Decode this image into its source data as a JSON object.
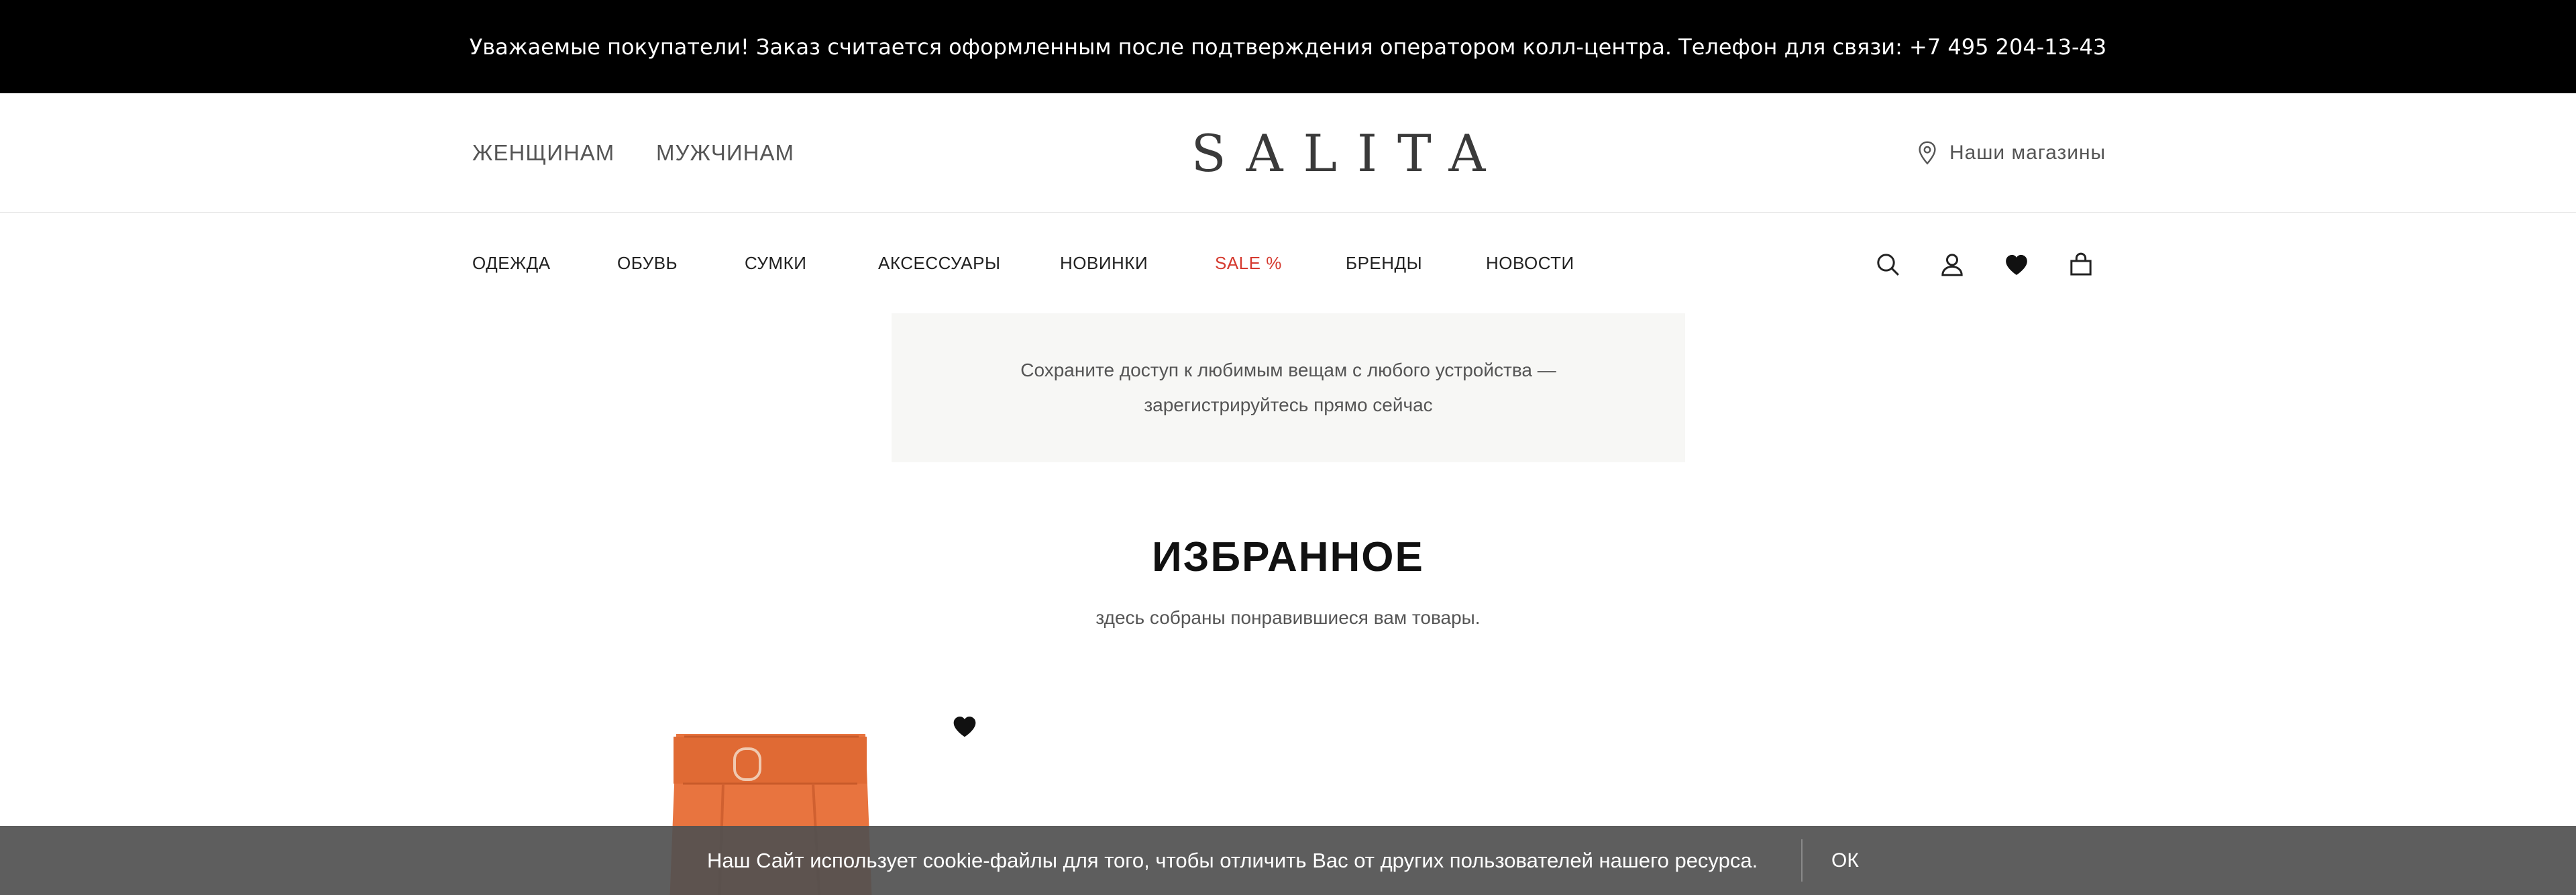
{
  "announcement": "Уважаемые покупатели! Заказ считается оформленным после подтверждения оператором колл-центра. Телефон для связи: +7 495 204-13-43",
  "header": {
    "women": "ЖЕНЩИНАМ",
    "men": "МУЖЧИНАМ",
    "logo": "SALITA",
    "stores": "Наши магазины"
  },
  "nav": {
    "items": [
      "ОДЕЖДА",
      "ОБУВЬ",
      "СУМКИ",
      "АКСЕССУАРЫ",
      "НОВИНКИ",
      "SALE %",
      "БРЕНДЫ",
      "НОВОСТИ"
    ],
    "icons": [
      "search-icon",
      "user-icon",
      "heart-icon",
      "bag-icon"
    ],
    "sale_color": "#d53a2f"
  },
  "promo": {
    "line1": "Сохраните доступ к любимым вещам с любого устройства —",
    "line2": "зарегистрируйтесь прямо сейчас"
  },
  "favorites": {
    "title": "ИЗБРАННОЕ",
    "subtitle": "здесь собраны понравившиеся вам товары."
  },
  "product": {
    "color": "#e8743f"
  },
  "cookie": {
    "text": "Наш Сайт использует cookie-файлы для того, чтобы отличить Вас от других пользователей нашего ресурса.",
    "ok": "ОК"
  }
}
